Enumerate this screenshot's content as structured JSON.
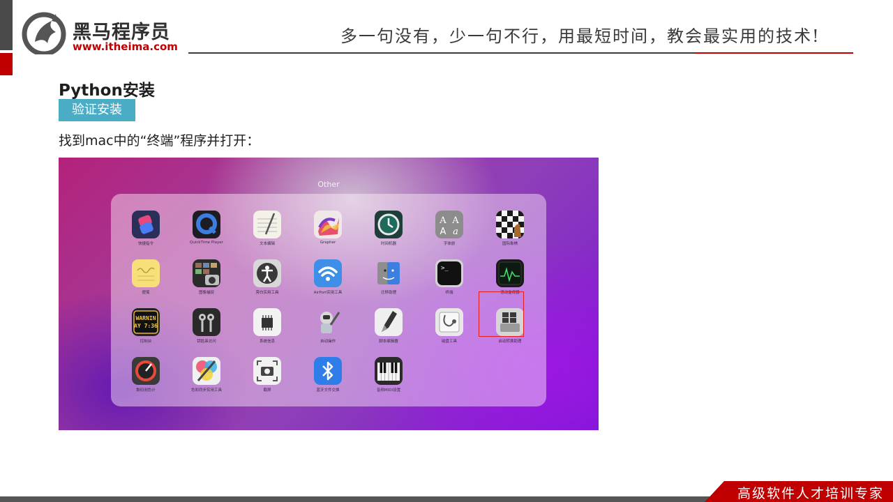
{
  "header": {
    "brand_name": "黑马程序员",
    "brand_url": "www.itheima.com",
    "slogan": "多一句没有，少一句不行，用最短时间，教会最实用的技术!"
  },
  "slide": {
    "title": "Python安装",
    "badge": "验证安装",
    "description": "找到mac中的“终端”程序并打开："
  },
  "launchpad": {
    "folder_title": "Other",
    "apps": [
      {
        "label": "快捷指令",
        "icon": "shortcuts-icon"
      },
      {
        "label": "QuickTime Player",
        "icon": "quicktime-icon"
      },
      {
        "label": "文本编辑",
        "icon": "textedit-icon"
      },
      {
        "label": "Grapher",
        "icon": "grapher-icon"
      },
      {
        "label": "时间机器",
        "icon": "time-machine-icon"
      },
      {
        "label": "字体册",
        "icon": "font-book-icon"
      },
      {
        "label": "国际象棋",
        "icon": "chess-icon"
      },
      {
        "label": "便笺",
        "icon": "stickies-icon"
      },
      {
        "label": "图像捕捉",
        "icon": "image-capture-icon"
      },
      {
        "label": "旁白实用工具",
        "icon": "voiceover-utility-icon"
      },
      {
        "label": "AirPort实用工具",
        "icon": "airport-utility-icon"
      },
      {
        "label": "迁移助理",
        "icon": "migration-assistant-icon"
      },
      {
        "label": "终端",
        "icon": "terminal-icon"
      },
      {
        "label": "活动监视器",
        "icon": "activity-monitor-icon"
      },
      {
        "label": "控制台",
        "icon": "console-icon"
      },
      {
        "label": "钥匙串访问",
        "icon": "keychain-access-icon"
      },
      {
        "label": "系统信息",
        "icon": "system-information-icon"
      },
      {
        "label": "自动操作",
        "icon": "automator-icon"
      },
      {
        "label": "脚本编辑器",
        "icon": "script-editor-icon"
      },
      {
        "label": "磁盘工具",
        "icon": "disk-utility-icon"
      },
      {
        "label": "启动转换助理",
        "icon": "boot-camp-assistant-icon"
      },
      {
        "label": "数码测色计",
        "icon": "digital-color-meter-icon"
      },
      {
        "label": "色彩同步实用工具",
        "icon": "colorsync-utility-icon"
      },
      {
        "label": "截屏",
        "icon": "screenshot-icon"
      },
      {
        "label": "蓝牙文件交换",
        "icon": "bluetooth-file-exchange-icon"
      },
      {
        "label": "音频MIDI设置",
        "icon": "audio-midi-setup-icon"
      }
    ],
    "terminal_prompt": ">_",
    "console_text": [
      "WARNIN",
      "AY 7:36"
    ],
    "font_book_text": [
      "A",
      "A",
      "A",
      "a"
    ],
    "highlighted_app": "终端"
  },
  "footer": {
    "tagline": "高级软件人才培训专家"
  },
  "colors": {
    "brand_red": "#c00000",
    "badge_blue": "#4bacc6",
    "highlight_red": "#e02020"
  }
}
